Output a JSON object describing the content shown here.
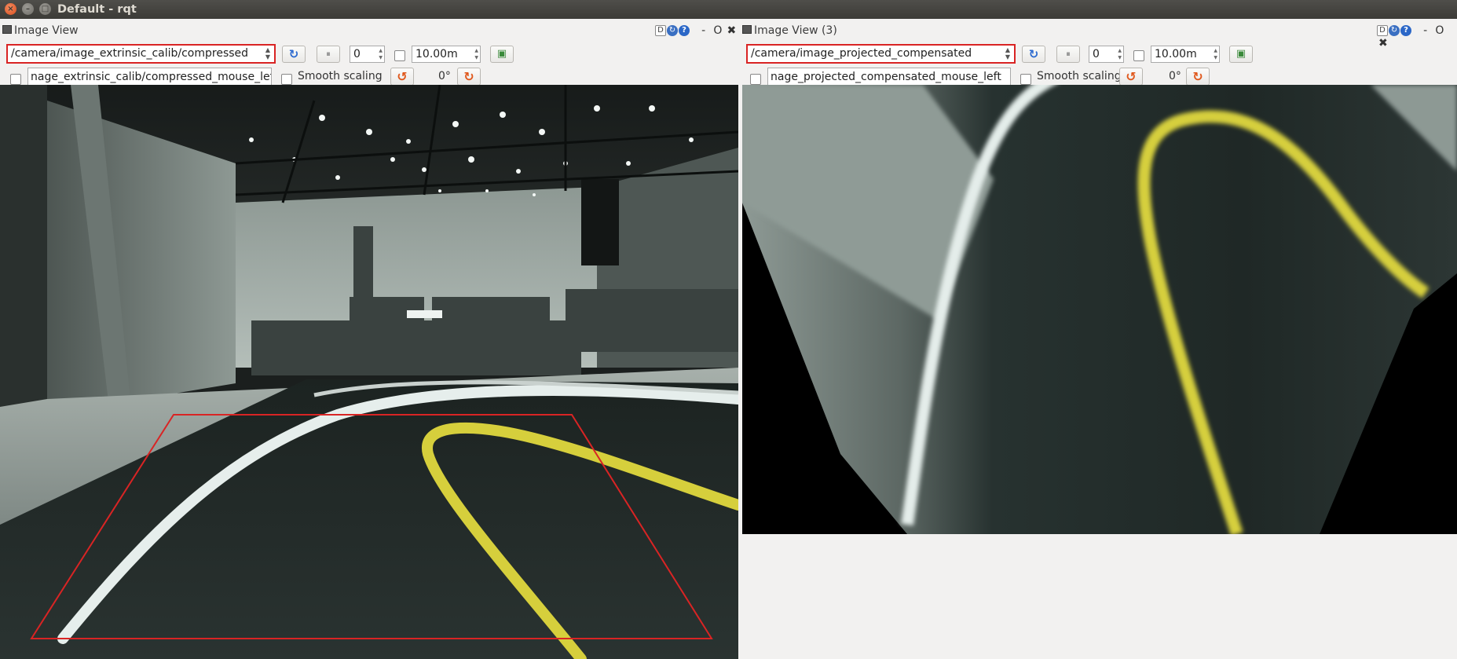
{
  "window": {
    "title": "Default - rqt"
  },
  "left_pane": {
    "title": "Image View",
    "topic": "/camera/image_extrinsic_calib/compressed",
    "spin_value": "0",
    "timeout": "10.00m",
    "mouse_topic": "nage_extrinsic_calib/compressed_mouse_left",
    "smooth_label": "Smooth scaling",
    "rotation": "0°"
  },
  "right_pane": {
    "title": "Image View (3)",
    "topic": "/camera/image_projected_compensated",
    "spin_value": "0",
    "timeout": "10.00m",
    "mouse_topic": "nage_projected_compensated_mouse_left",
    "smooth_label": "Smooth scaling",
    "rotation": "0°"
  },
  "dock_icons": {
    "d": "D",
    "minimize": "-",
    "float": "O",
    "close": "✖"
  },
  "colors": {
    "highlight": "#d92424",
    "lane_yellow": "#d6cf3c",
    "lane_white": "#e8f0ee"
  }
}
